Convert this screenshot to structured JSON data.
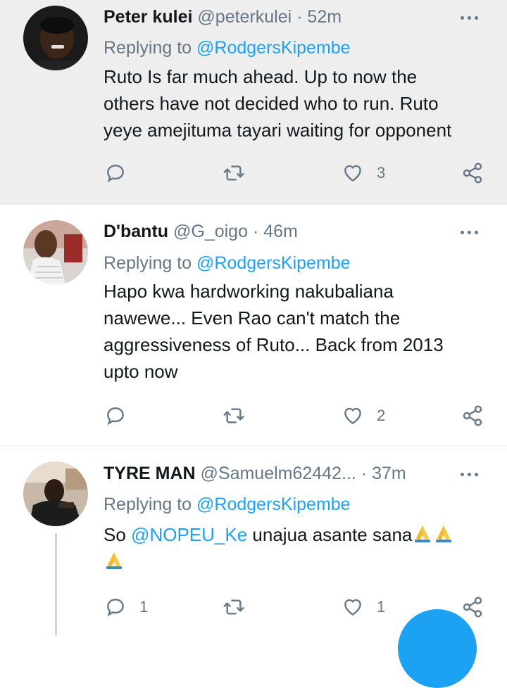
{
  "tweets": [
    {
      "name": "Peter kulei",
      "handle": "@peterkulei",
      "separator": "·",
      "time": "52m",
      "replying_prefix": "Replying to",
      "replying_to": "@RodgersKipembe",
      "body_lines": [
        "Ruto Is far much ahead. Up to now the",
        "others have not decided who to run. Ruto",
        "yeye amejituma tayari waiting for opponent"
      ],
      "reply_count": "",
      "like_count": "3"
    },
    {
      "name": "D'bantu",
      "handle": "@G_oigo",
      "separator": "·",
      "time": "46m",
      "replying_prefix": "Replying to",
      "replying_to": "@RodgersKipembe",
      "body_lines": [
        "Hapo kwa hardworking nakubaliana",
        "nawewe... Even Rao can't match the",
        "aggressiveness of Ruto... Back from 2013",
        "upto now"
      ],
      "reply_count": "",
      "like_count": "2"
    },
    {
      "name": "TYRE MAN",
      "handle": "@Samuelm62442...",
      "separator": "·",
      "time": "37m",
      "replying_prefix": "Replying to",
      "replying_to": "@RodgersKipembe",
      "body_prefix": "So",
      "body_mention": "@NOPEU_Ke",
      "body_suffix": "unajua asante sana",
      "emoji": "folded-hands",
      "reply_count": "1",
      "like_count": "1"
    }
  ],
  "colors": {
    "link": "#1da1f2",
    "muted": "#657786",
    "highlight_bg": "#eeeeee"
  }
}
